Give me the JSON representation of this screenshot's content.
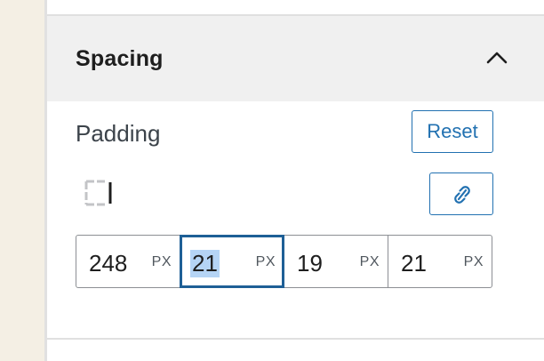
{
  "section": {
    "title": "Spacing",
    "collapse_icon": "chevron-up-icon"
  },
  "padding": {
    "label": "Padding",
    "reset_label": "Reset",
    "sides_icon": "box-sides-icon",
    "link_icon": "unlink-icon",
    "fields": [
      {
        "value": "248",
        "unit": "PX",
        "focused": false
      },
      {
        "value": "21",
        "unit": "PX",
        "focused": true,
        "selected": true
      },
      {
        "value": "19",
        "unit": "PX",
        "focused": false
      },
      {
        "value": "21",
        "unit": "PX",
        "focused": false
      }
    ]
  },
  "colors": {
    "accent": "#2271b1",
    "focus_border": "#1e5f96",
    "selection": "#b5d4f5",
    "canvas": "#f4efe4",
    "header_bg": "#f0f0f0"
  }
}
